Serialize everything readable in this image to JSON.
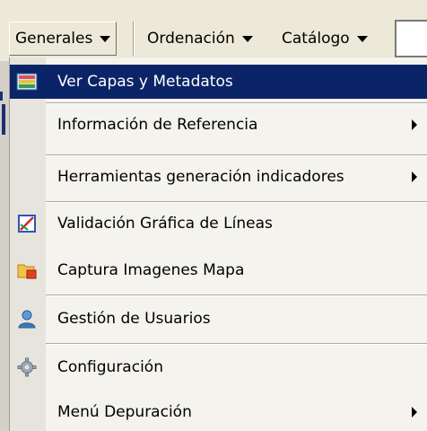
{
  "menubar": {
    "items": [
      {
        "label": "Generales"
      },
      {
        "label": "Ordenación"
      },
      {
        "label": "Catálogo"
      }
    ]
  },
  "menu": {
    "items": [
      {
        "label": "Ver Capas y Metadatos",
        "icon": "layers-map-icon",
        "highlighted": true
      },
      {
        "label": "Información de Referencia",
        "submenu": true
      },
      {
        "label": "Herramientas generación indicadores",
        "submenu": true
      },
      {
        "label": "Validación Gráfica de Líneas",
        "icon": "line-validation-icon"
      },
      {
        "label": "Captura Imagenes Mapa",
        "icon": "folder-capture-icon"
      },
      {
        "label": "Gestión de Usuarios",
        "icon": "user-icon"
      },
      {
        "label": "Configuración",
        "icon": "gear-icon"
      },
      {
        "label": "Menú Depuración",
        "submenu": true
      }
    ]
  },
  "colors": {
    "highlight": "#0b2467",
    "menu_bg": "#f4f3ee",
    "bar_bg": "#ece9d8"
  }
}
